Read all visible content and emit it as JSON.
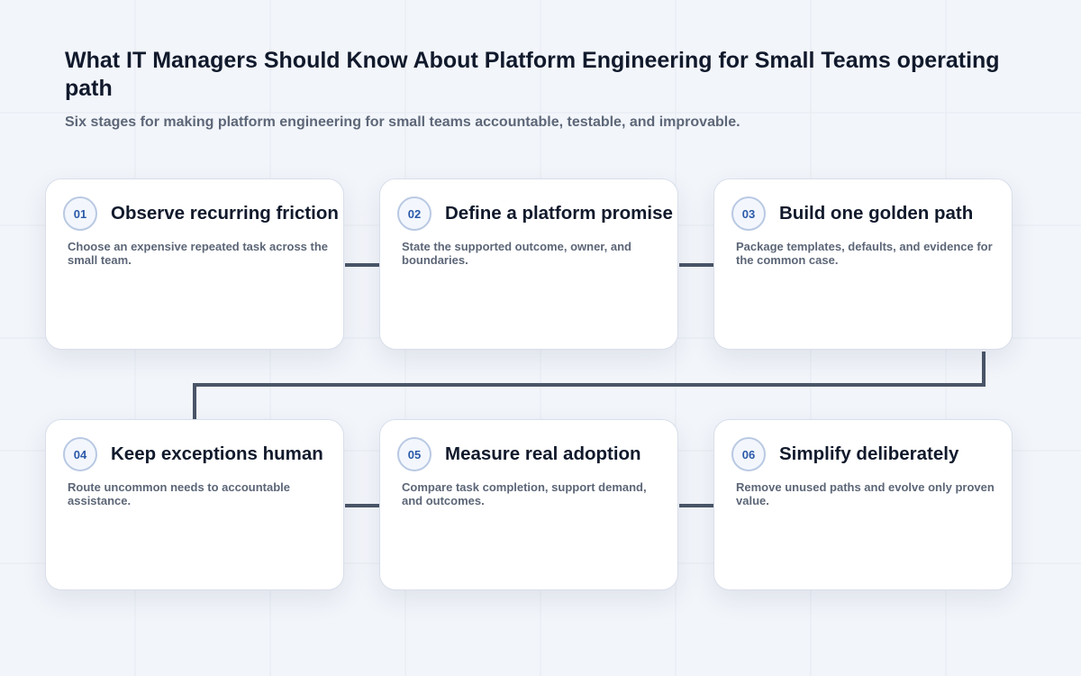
{
  "header": {
    "title": "What IT Managers Should Know About Platform Engineering for Small Teams operating path",
    "subtitle": "Six stages for making platform engineering for small teams accountable, testable, and improvable."
  },
  "colors": {
    "background": "#f2f5fa",
    "card": "#ffffff",
    "connector": "#4a5568",
    "badge_text": "#2b5aa8",
    "title_text": "#111a2c",
    "body_text": "#5c6677"
  },
  "stages": [
    {
      "number": "01",
      "title": "Observe recurring friction",
      "description": "Choose an expensive repeated task across the small team."
    },
    {
      "number": "02",
      "title": "Define a platform promise",
      "description": "State the supported outcome, owner, and boundaries."
    },
    {
      "number": "03",
      "title": "Build one golden path",
      "description": "Package templates, defaults, and evidence for the common case."
    },
    {
      "number": "04",
      "title": "Keep exceptions human",
      "description": "Route uncommon needs to accountable assistance."
    },
    {
      "number": "05",
      "title": "Measure real adoption",
      "description": "Compare task completion, support demand, and outcomes."
    },
    {
      "number": "06",
      "title": "Simplify deliberately",
      "description": "Remove unused paths and evolve only proven value."
    }
  ]
}
